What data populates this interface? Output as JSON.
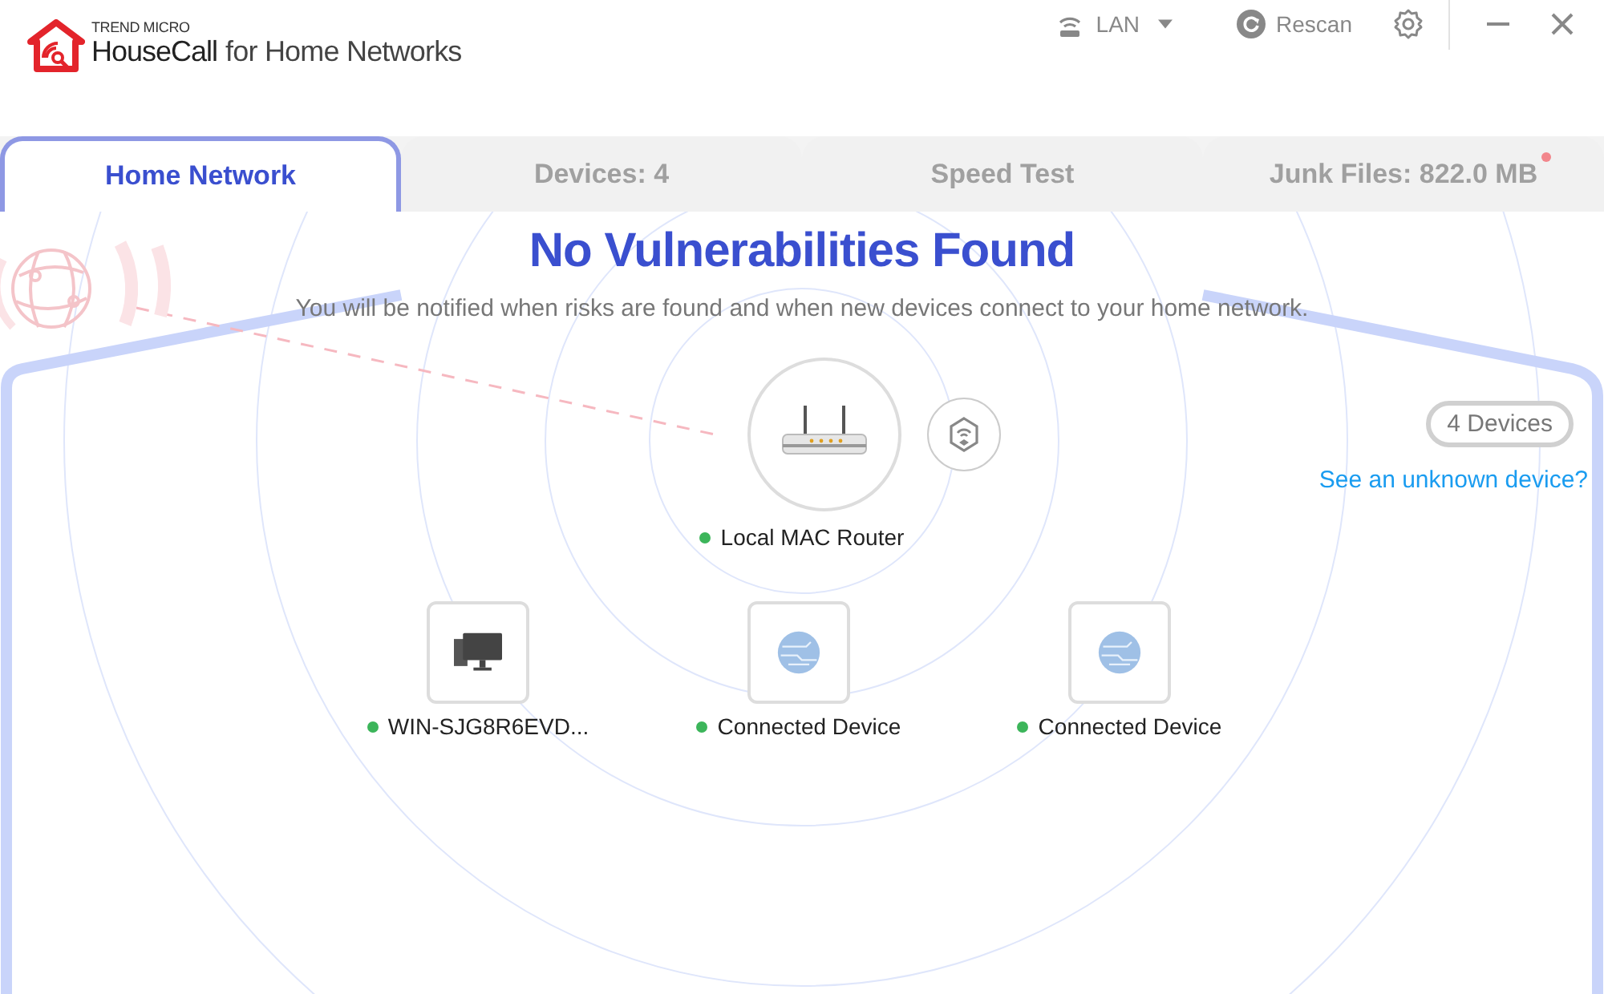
{
  "app": {
    "brand": "TREND MICRO",
    "name": "HouseCall",
    "subtitle": "for Home Networks"
  },
  "toolbar": {
    "connection": "LAN",
    "rescan": "Rescan"
  },
  "tabs": [
    {
      "label": "Home Network",
      "selected": true,
      "notification": false
    },
    {
      "label": "Devices: 4",
      "selected": false,
      "notification": false
    },
    {
      "label": "Speed Test",
      "selected": false,
      "notification": false
    },
    {
      "label": "Junk Files: 822.0 MB",
      "selected": false,
      "notification": true
    }
  ],
  "status": {
    "title": "No Vulnerabilities Found",
    "message": "You will be notified when risks are found and when new devices connect to your home network."
  },
  "router": {
    "name": "Local MAC Router",
    "online": true
  },
  "device_count": "4 Devices",
  "unknown_link": "See an unknown device?",
  "devices": [
    {
      "kind": "computer",
      "name": "WIN-SJG8R6EVD...",
      "online": true
    },
    {
      "kind": "generic",
      "name": "Connected Device",
      "online": true
    },
    {
      "kind": "generic",
      "name": "Connected Device",
      "online": true
    }
  ]
}
